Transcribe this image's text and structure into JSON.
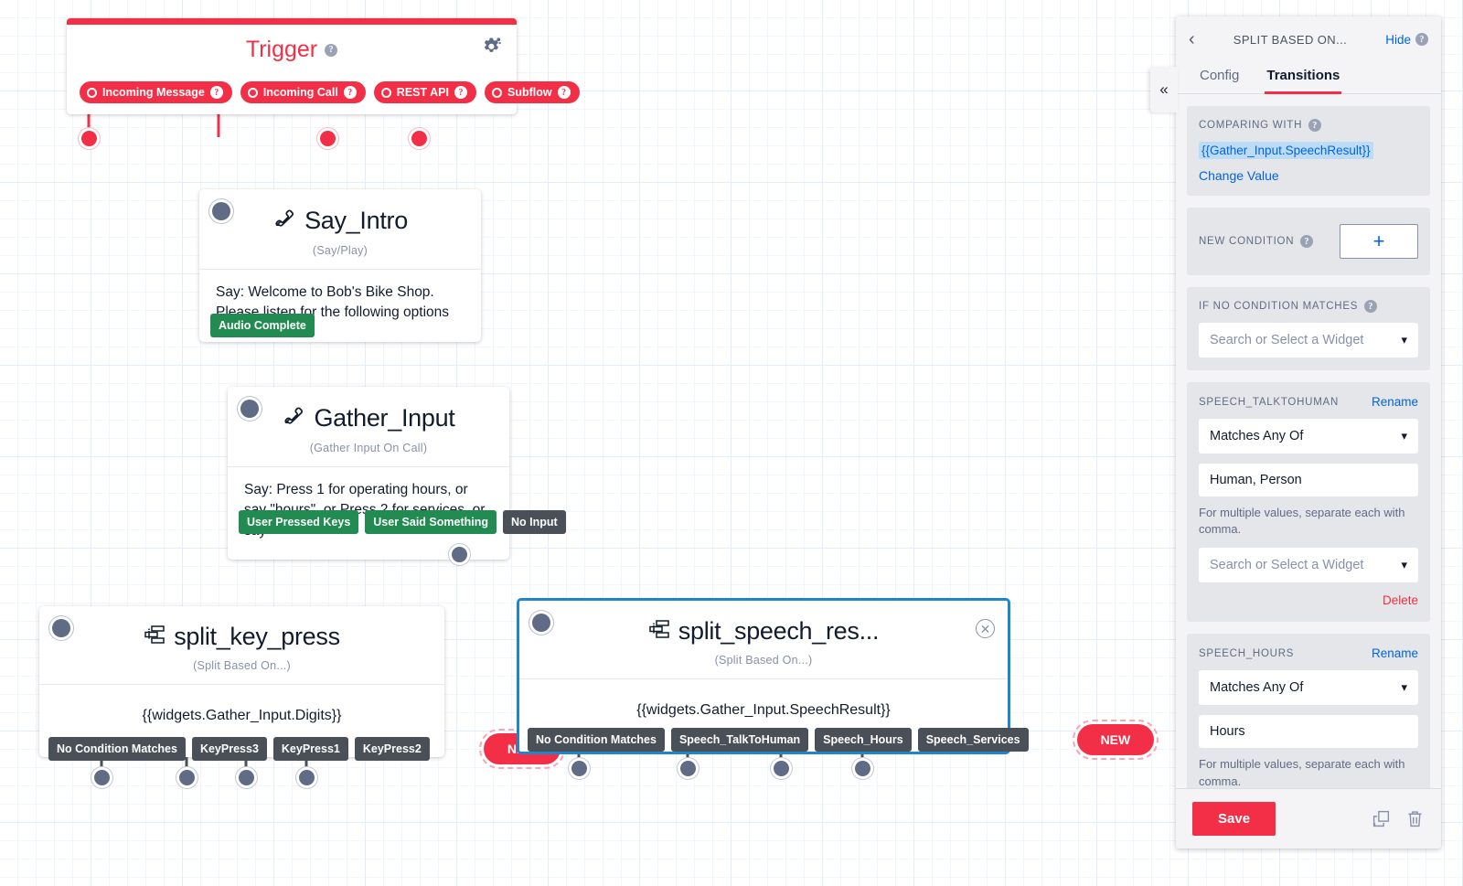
{
  "canvas": {
    "trigger": {
      "name": "trigger-widget",
      "title": "Trigger",
      "help_icon": "help-icon",
      "gear_icon": "gear-icon",
      "outputs": [
        {
          "label": "Incoming Message",
          "type": "red"
        },
        {
          "label": "Incoming Call",
          "type": "red"
        },
        {
          "label": "REST API",
          "type": "red"
        },
        {
          "label": "Subflow",
          "type": "red"
        }
      ],
      "accent_color": "#f22f46"
    },
    "nodes": [
      {
        "id": "say_intro",
        "icon": "phone-handset-icon",
        "title": "Say_Intro",
        "subtitle": "(Say/Play)",
        "body": "Say: Welcome to Bob's Bike Shop. Please listen for the following options",
        "outputs": [
          {
            "label": "Audio Complete",
            "type": "green"
          }
        ]
      },
      {
        "id": "gather_input",
        "icon": "phone-handset-icon",
        "title": "Gather_Input",
        "subtitle": "(Gather Input On Call)",
        "body": "Say: Press 1 for operating hours, or say \"hours\". or Press 2 for services, or say",
        "outputs": [
          {
            "label": "User Pressed Keys",
            "type": "green"
          },
          {
            "label": "User Said Something",
            "type": "green"
          },
          {
            "label": "No Input",
            "type": "gray"
          }
        ]
      },
      {
        "id": "split_key_press",
        "icon": "split-icon",
        "title": "split_key_press",
        "subtitle": "(Split Based On...)",
        "body": "{{widgets.Gather_Input.Digits}}",
        "selected": false,
        "outputs": [
          {
            "label": "No Condition Matches",
            "type": "gray"
          },
          {
            "label": "KeyPress3",
            "type": "gray"
          },
          {
            "label": "KeyPress1",
            "type": "gray"
          },
          {
            "label": "KeyPress2",
            "type": "gray"
          }
        ],
        "new_label": "NEW"
      },
      {
        "id": "split_speech_result",
        "icon": "split-icon",
        "title": "split_speech_res...",
        "subtitle": "(Split Based On...)",
        "body": "{{widgets.Gather_Input.SpeechResult}}",
        "selected": true,
        "close_icon": "close-icon",
        "outputs": [
          {
            "label": "No Condition Matches",
            "type": "gray"
          },
          {
            "label": "Speech_TalkToHuman",
            "type": "gray"
          },
          {
            "label": "Speech_Hours",
            "type": "gray"
          },
          {
            "label": "Speech_Services",
            "type": "gray"
          }
        ],
        "new_label": "NEW"
      }
    ]
  },
  "panel": {
    "back_icon": "chevron-left-icon",
    "title": "SPLIT BASED ON...",
    "hide_label": "Hide",
    "hide_help_icon": "help-icon",
    "collapse_icon": "double-chevron-left-icon",
    "tabs": [
      {
        "label": "Config",
        "active": false
      },
      {
        "label": "Transitions",
        "active": true
      }
    ],
    "comparing_with": {
      "label": "COMPARING WITH",
      "help_icon": "help-icon",
      "value": "{{Gather_Input.SpeechResult}}",
      "change_value_link": "Change Value"
    },
    "new_condition": {
      "label": "NEW CONDITION",
      "help_icon": "help-icon",
      "add_label": "+"
    },
    "if_no_condition": {
      "label": "IF NO CONDITION MATCHES",
      "help_icon": "help-icon",
      "widget_placeholder": "Search or Select a Widget",
      "chevron_icon": "chevron-down-icon"
    },
    "conditions": [
      {
        "name": "SPEECH_TALKTOHUMAN",
        "rename_label": "Rename",
        "operator": "Matches Any Of",
        "value": "Human, Person",
        "helper": "For multiple values, separate each with comma.",
        "widget_placeholder": "Search or Select a Widget",
        "delete_label": "Delete",
        "chevron_icon": "chevron-down-icon"
      },
      {
        "name": "SPEECH_HOURS",
        "rename_label": "Rename",
        "operator": "Matches Any Of",
        "value": "Hours",
        "helper": "For multiple values, separate each with comma.",
        "widget_placeholder": "",
        "delete_label": "",
        "chevron_icon": "chevron-down-icon"
      }
    ],
    "footer": {
      "save_label": "Save",
      "duplicate_icon": "duplicate-icon",
      "delete_icon": "trash-icon"
    },
    "scrollbar": "vertical-scrollbar"
  }
}
